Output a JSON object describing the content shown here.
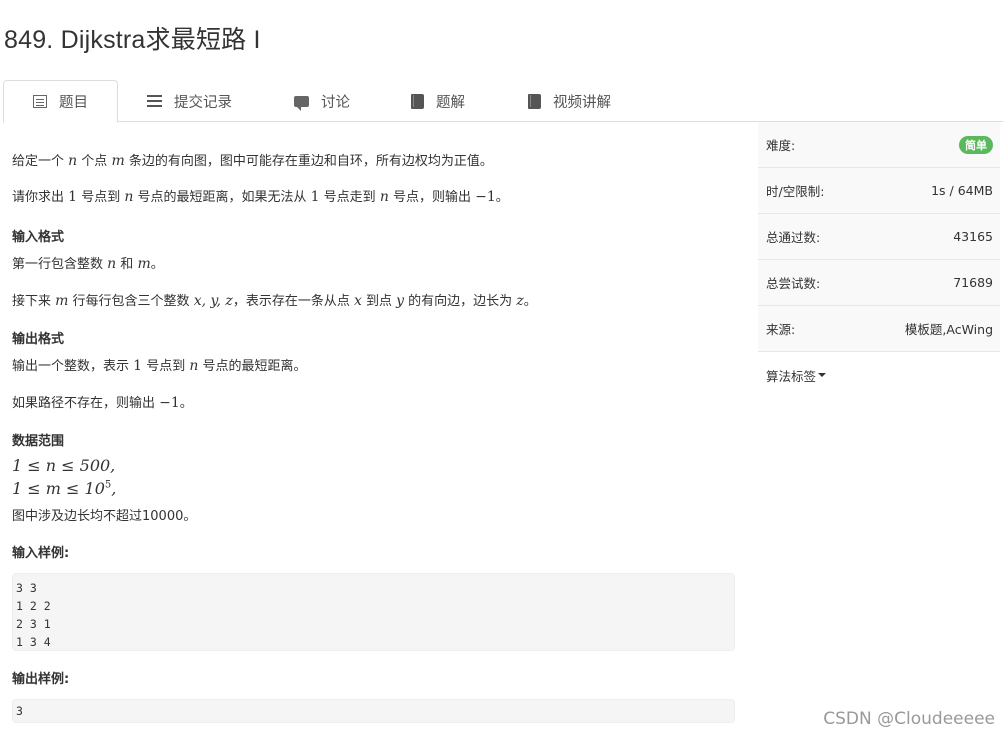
{
  "problem": {
    "title": "849. Dijkstra求最短路 I"
  },
  "tabs": [
    {
      "label": "题目",
      "icon": "list-icon"
    },
    {
      "label": "提交记录",
      "icon": "lines-icon"
    },
    {
      "label": "讨论",
      "icon": "comment-icon"
    },
    {
      "label": "题解",
      "icon": "book-icon"
    },
    {
      "label": "视频讲解",
      "icon": "book-icon"
    }
  ],
  "statement": {
    "intro_1_a": "给定一个 ",
    "var_n": "n",
    "intro_1_b": " 个点 ",
    "var_m": "m",
    "intro_1_c": " 条边的有向图，图中可能存在重边和自环，所有边权均为正值。",
    "intro_2_a": "请你求出 ",
    "num_1": "1",
    "intro_2_b": " 号点到 ",
    "intro_2_c": " 号点的最短距离，如果无法从 ",
    "intro_2_d": " 号点走到 ",
    "intro_2_e": " 号点，则输出 ",
    "neg_1": "−1",
    "period": "。"
  },
  "input_format": {
    "heading": "输入格式",
    "line1_a": "第一行包含整数 ",
    "line1_b": " 和 ",
    "line2_a": "接下来 ",
    "line2_b": " 行每行包含三个整数 ",
    "xyz": "x, y, z",
    "line2_c": "，表示存在一条从点 ",
    "var_x": "x",
    "line2_d": " 到点 ",
    "var_y": "y",
    "line2_e": " 的有向边，边长为 ",
    "var_z": "z"
  },
  "output_format": {
    "heading": "输出格式",
    "line1_a": "输出一个整数，表示 ",
    "line1_b": " 号点到 ",
    "line1_c": " 号点的最短距离。",
    "line2_a": "如果路径不存在，则输出 "
  },
  "range": {
    "heading": "数据范围",
    "c1": "1 ≤ n ≤ 500,",
    "c2_a": "1 ≤ m ≤ 10",
    "c2_sup": "5",
    "c2_b": ",",
    "c3": "图中涉及边长均不超过10000。"
  },
  "sample_input": {
    "heading": "输入样例:",
    "text": "3 3\n1 2 2\n2 3 1\n1 3 4"
  },
  "sample_output": {
    "heading": "输出样例:",
    "text": "3"
  },
  "info": {
    "difficulty_label": "难度:",
    "difficulty_value": "简单",
    "limit_label": "时/空限制:",
    "limit_value": "1s / 64MB",
    "passed_label": "总通过数:",
    "passed_value": "43165",
    "tried_label": "总尝试数:",
    "tried_value": "71689",
    "source_label": "来源:",
    "source_value": "模板题,AcWing",
    "tags_label": "算法标签"
  },
  "watermark": "CSDN @Cloudeeeee",
  "colors": {
    "badge_green": "#5cb85c",
    "border": "#dddddd",
    "panel_bg": "#f9f9f9"
  }
}
